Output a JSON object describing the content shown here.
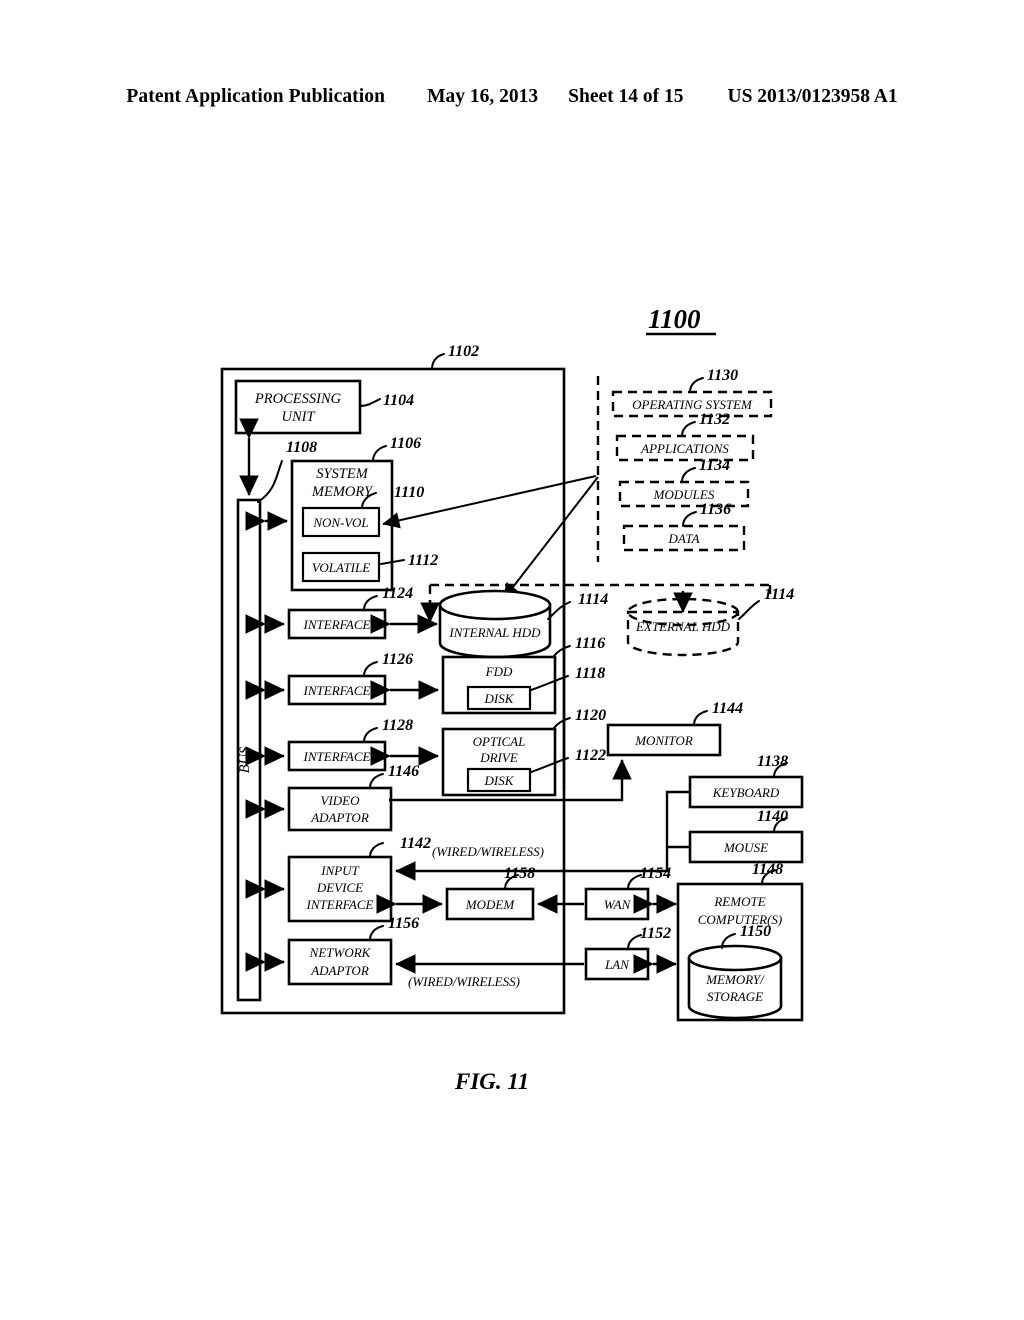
{
  "header": {
    "publication": "Patent Application Publication",
    "date": "May 16, 2013",
    "sheet": "Sheet 14 of 15",
    "patent_number": "US 2013/0123958 A1"
  },
  "figure": {
    "system_number": "1100",
    "caption": "FIG. 11"
  },
  "blocks": {
    "processing_unit": {
      "label_line1": "PROCESSING",
      "label_line2": "UNIT",
      "ref": "1104"
    },
    "system_memory": {
      "label_line1": "SYSTEM",
      "label_line2": "MEMORY",
      "ref": "1106"
    },
    "non_vol": {
      "label": "NON-VOL",
      "ref": "1110"
    },
    "volatile": {
      "label": "VOLATILE",
      "ref": "1112"
    },
    "bus": {
      "label": "BUS",
      "ref": "1108"
    },
    "computer_enclosure": {
      "ref": "1102"
    },
    "interface_hdd": {
      "label": "INTERFACE",
      "ref": "1124"
    },
    "interface_fdd": {
      "label": "INTERFACE",
      "ref": "1126"
    },
    "interface_optical": {
      "label": "INTERFACE",
      "ref": "1128"
    },
    "video_adaptor": {
      "label_line1": "VIDEO",
      "label_line2": "ADAPTOR",
      "ref": "1146"
    },
    "input_device_interface": {
      "label_line1": "INPUT",
      "label_line2": "DEVICE",
      "label_line3": "INTERFACE",
      "ref": "1142"
    },
    "network_adaptor": {
      "label_line1": "NETWORK",
      "label_line2": "ADAPTOR",
      "ref": "1156"
    },
    "internal_hdd": {
      "label": "INTERNAL HDD",
      "ref": "1114"
    },
    "external_hdd": {
      "label": "EXTERNAL HDD",
      "ref": "1114"
    },
    "fdd": {
      "label": "FDD",
      "ref": "1116"
    },
    "fdd_disk": {
      "label": "DISK",
      "ref": "1118"
    },
    "optical_drive": {
      "label_line1": "OPTICAL",
      "label_line2": "DRIVE",
      "ref": "1120"
    },
    "optical_disk": {
      "label": "DISK",
      "ref": "1122"
    },
    "monitor": {
      "label": "MONITOR",
      "ref": "1144"
    },
    "keyboard": {
      "label": "KEYBOARD",
      "ref": "1138"
    },
    "mouse": {
      "label": "MOUSE",
      "ref": "1140"
    },
    "modem": {
      "label": "MODEM",
      "ref": "1158"
    },
    "wan": {
      "label": "WAN",
      "ref": "1154"
    },
    "lan": {
      "label": "LAN",
      "ref": "1152"
    },
    "remote_computers": {
      "label_line1": "REMOTE",
      "label_line2": "COMPUTER(S)",
      "ref": "1148"
    },
    "memory_storage": {
      "label_line1": "MEMORY/",
      "label_line2": "STORAGE",
      "ref": "1150"
    }
  },
  "software_stack": {
    "operating_system": {
      "label": "OPERATING SYSTEM",
      "ref": "1130"
    },
    "applications": {
      "label": "APPLICATIONS",
      "ref": "1132"
    },
    "modules": {
      "label": "MODULES",
      "ref": "1134"
    },
    "data": {
      "label": "DATA",
      "ref": "1136"
    }
  },
  "annotations": {
    "wired_wireless_top": "(WIRED/WIRELESS)",
    "wired_wireless_bottom": "(WIRED/WIRELESS)"
  }
}
